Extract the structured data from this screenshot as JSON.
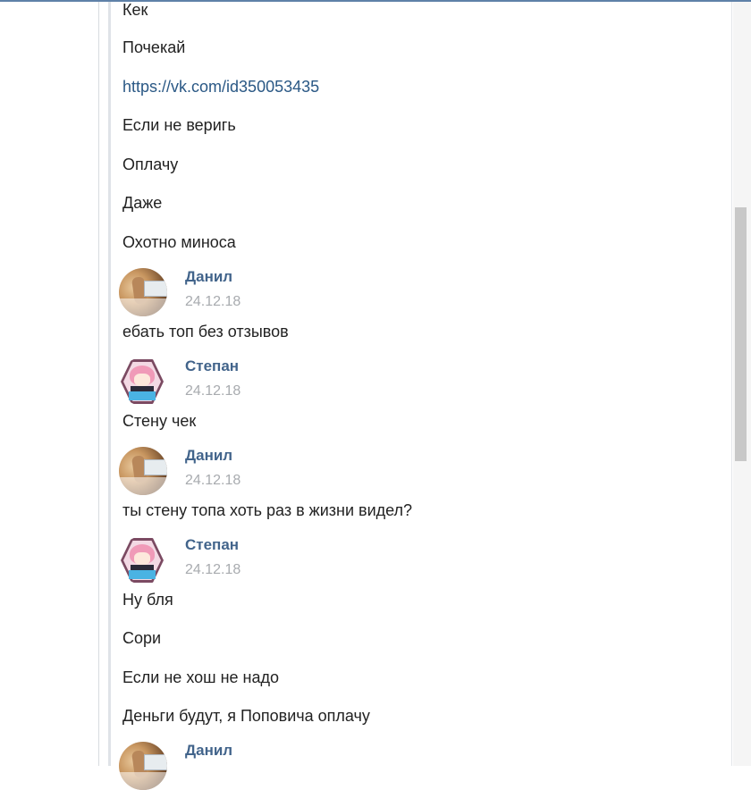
{
  "messages_top": [
    {
      "text": "Кек"
    },
    {
      "text": "Почекай"
    },
    {
      "text": "https://vk.com/id350053435",
      "link": true
    },
    {
      "text": "Если не веригь"
    },
    {
      "text": "Оплачу"
    },
    {
      "text": "Даже"
    },
    {
      "text": "Охотно миноса"
    }
  ],
  "posts": [
    {
      "author": "Данил",
      "date": "24.12.18",
      "avatar": "danil-avatar",
      "messages": [
        "ебать топ без отзывов"
      ]
    },
    {
      "author": "Степан",
      "date": "24.12.18",
      "avatar": "stepan-avatar",
      "messages": [
        "Стену чек"
      ]
    },
    {
      "author": "Данил",
      "date": "24.12.18",
      "avatar": "danil-avatar",
      "messages": [
        "ты стену топа хоть раз в жизни видел?"
      ]
    },
    {
      "author": "Степан",
      "date": "24.12.18",
      "avatar": "stepan-avatar",
      "messages": [
        "Ну бля",
        "Сори",
        "Если не хош не надо",
        "Деньги будут, я Поповича оплачу"
      ]
    },
    {
      "author": "Данил",
      "avatar": "danil-avatar"
    }
  ],
  "colors": {
    "author": "#42648b",
    "link": "#2a5885",
    "date": "#a8abaf",
    "text": "#222222"
  }
}
